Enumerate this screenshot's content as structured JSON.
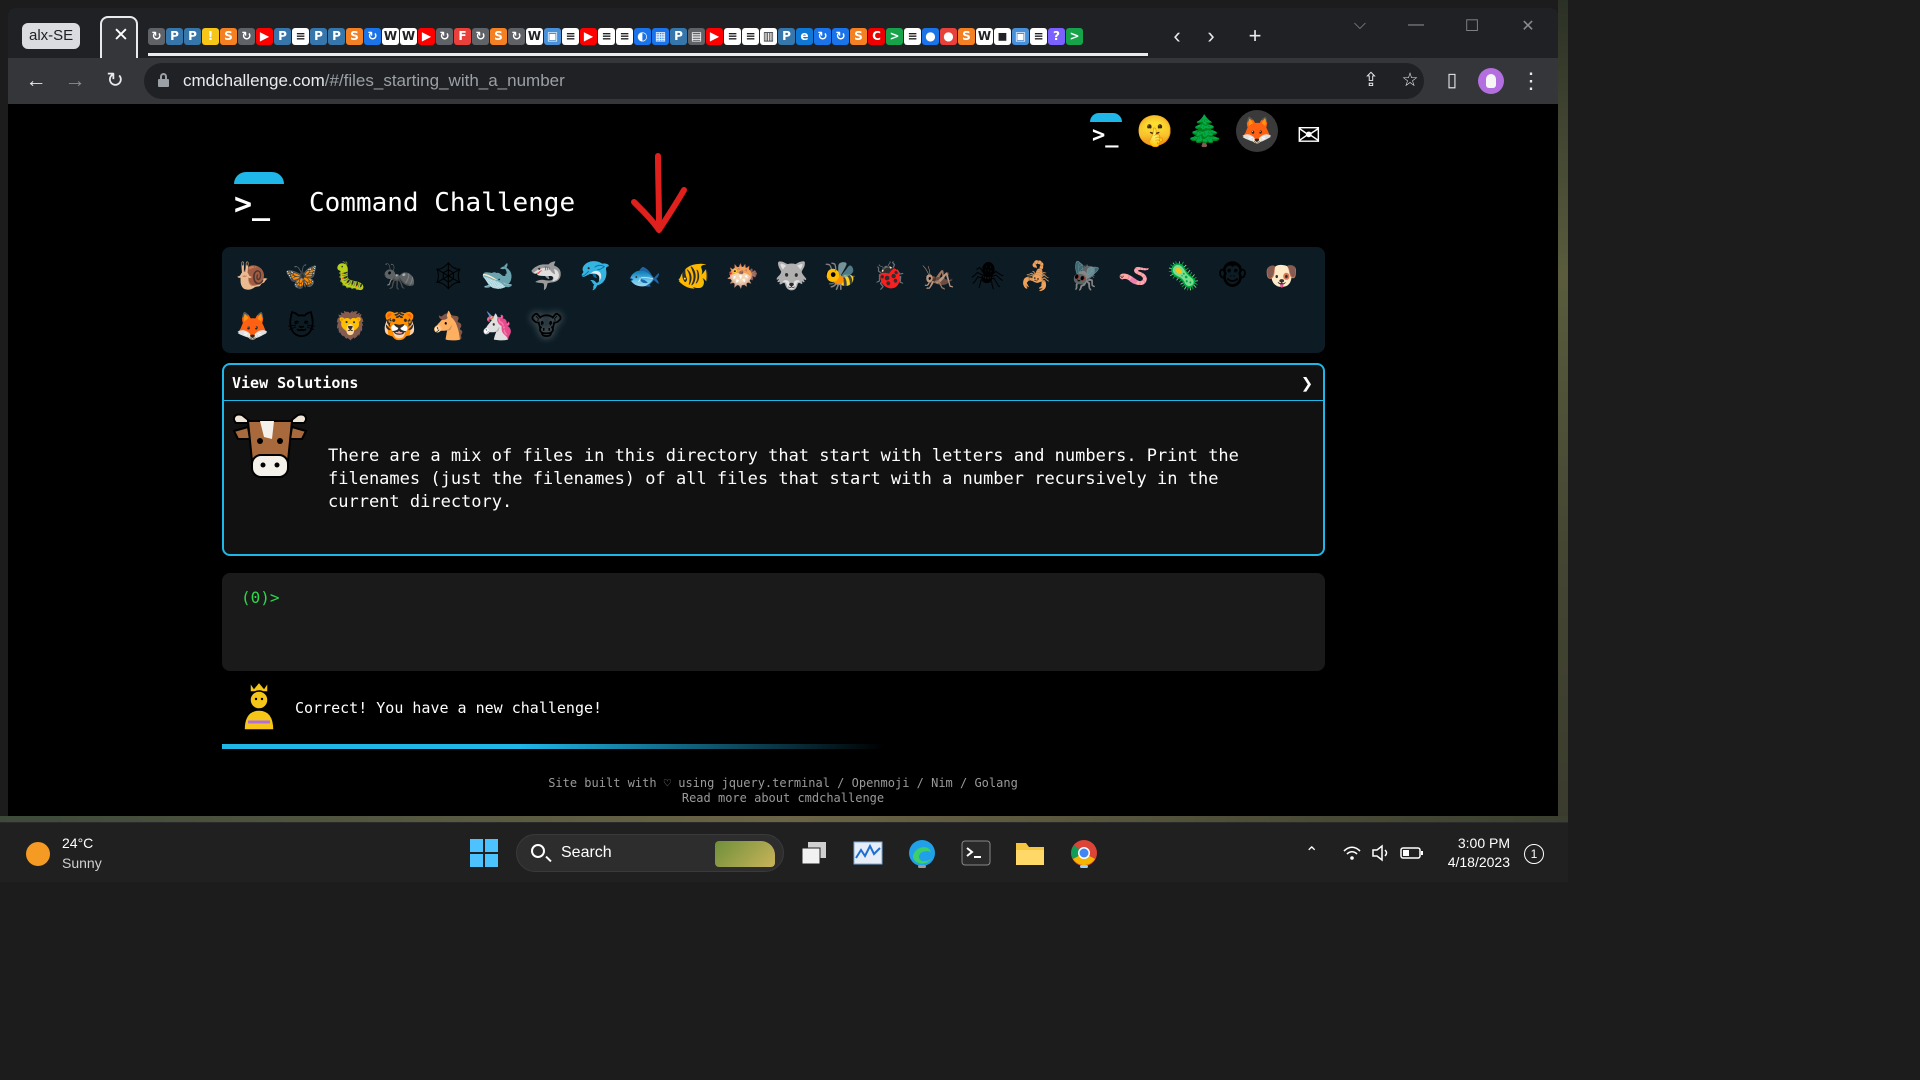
{
  "browser": {
    "tab_group_label": "alx-SE",
    "active_tab_close": "✕",
    "tab_favicons": [
      {
        "icon": "refresh-favicon",
        "color": "#5f6368",
        "glyph": "↻"
      },
      {
        "icon": "python-favicon",
        "color": "#3776ab",
        "glyph": "P"
      },
      {
        "icon": "python-favicon",
        "color": "#3776ab",
        "glyph": "P"
      },
      {
        "icon": "generic-favicon",
        "color": "#f5c518",
        "glyph": "!"
      },
      {
        "icon": "stackoverflow-favicon",
        "color": "#f48024",
        "glyph": "S"
      },
      {
        "icon": "refresh-favicon",
        "color": "#5f6368",
        "glyph": "↻"
      },
      {
        "icon": "youtube-favicon",
        "color": "#ff0000",
        "glyph": "▶"
      },
      {
        "icon": "python-favicon",
        "color": "#3776ab",
        "glyph": "P"
      },
      {
        "icon": "doc-favicon",
        "color": "#ffffff",
        "glyph": "≡"
      },
      {
        "icon": "python-favicon",
        "color": "#3776ab",
        "glyph": "P"
      },
      {
        "icon": "python-favicon",
        "color": "#3776ab",
        "glyph": "P"
      },
      {
        "icon": "stackoverflow-favicon",
        "color": "#f48024",
        "glyph": "S"
      },
      {
        "icon": "refresh-favicon",
        "color": "#1a73e8",
        "glyph": "↻"
      },
      {
        "icon": "wikipedia-favicon",
        "color": "#ffffff",
        "glyph": "W"
      },
      {
        "icon": "wikipedia-favicon",
        "color": "#ffffff",
        "glyph": "W"
      },
      {
        "icon": "youtube-favicon",
        "color": "#ff0000",
        "glyph": "▶"
      },
      {
        "icon": "refresh-favicon",
        "color": "#5f6368",
        "glyph": "↻"
      },
      {
        "icon": "freecodecamp-favicon",
        "color": "#e8403a",
        "glyph": "F"
      },
      {
        "icon": "refresh-favicon",
        "color": "#5f6368",
        "glyph": "↻"
      },
      {
        "icon": "stackoverflow-favicon",
        "color": "#f48024",
        "glyph": "S"
      },
      {
        "icon": "refresh-favicon",
        "color": "#5f6368",
        "glyph": "↻"
      },
      {
        "icon": "wikipedia-favicon",
        "color": "#ffffff",
        "glyph": "W"
      },
      {
        "icon": "image-favicon",
        "color": "#4a90d9",
        "glyph": "▣"
      },
      {
        "icon": "doc-favicon",
        "color": "#ffffff",
        "glyph": "≡"
      },
      {
        "icon": "youtube-favicon",
        "color": "#ff0000",
        "glyph": "▶"
      },
      {
        "icon": "doc-favicon",
        "color": "#ffffff",
        "glyph": "≡"
      },
      {
        "icon": "doc-favicon",
        "color": "#ffffff",
        "glyph": "≡"
      },
      {
        "icon": "circle-favicon",
        "color": "#1a73e8",
        "glyph": "◐"
      },
      {
        "icon": "grid-favicon",
        "color": "#1a73e8",
        "glyph": "▦"
      },
      {
        "icon": "python-favicon",
        "color": "#3776ab",
        "glyph": "P"
      },
      {
        "icon": "list-favicon",
        "color": "#5f6368",
        "glyph": "▤"
      },
      {
        "icon": "youtube-favicon",
        "color": "#ff0000",
        "glyph": "▶"
      },
      {
        "icon": "doc-favicon",
        "color": "#ffffff",
        "glyph": "≡"
      },
      {
        "icon": "doc-favicon",
        "color": "#ffffff",
        "glyph": "≡"
      },
      {
        "icon": "book-favicon",
        "color": "#ffffff",
        "glyph": "▥"
      },
      {
        "icon": "python-favicon",
        "color": "#3776ab",
        "glyph": "P"
      },
      {
        "icon": "edge-favicon",
        "color": "#0f78d4",
        "glyph": "e"
      },
      {
        "icon": "refresh-favicon",
        "color": "#1a73e8",
        "glyph": "↻"
      },
      {
        "icon": "refresh-favicon",
        "color": "#1a73e8",
        "glyph": "↻"
      },
      {
        "icon": "stackoverflow-favicon",
        "color": "#f48024",
        "glyph": "S"
      },
      {
        "icon": "redhat-favicon",
        "color": "#ee0000",
        "glyph": "C"
      },
      {
        "icon": "terminal-favicon",
        "color": "#16a34a",
        "glyph": ">"
      },
      {
        "icon": "doc-favicon",
        "color": "#ffffff",
        "glyph": "≡"
      },
      {
        "icon": "circle-favicon",
        "color": "#1a73e8",
        "glyph": "●"
      },
      {
        "icon": "circle-favicon",
        "color": "#e8403a",
        "glyph": "●"
      },
      {
        "icon": "stackoverflow-favicon",
        "color": "#f48024",
        "glyph": "S"
      },
      {
        "icon": "wikipedia-favicon",
        "color": "#ffffff",
        "glyph": "W"
      },
      {
        "icon": "zoom-favicon",
        "color": "#ffffff",
        "glyph": "◼"
      },
      {
        "icon": "image-favicon",
        "color": "#4a90d9",
        "glyph": "▣"
      },
      {
        "icon": "doc-favicon",
        "color": "#ffffff",
        "glyph": "≡"
      },
      {
        "icon": "question-favicon",
        "color": "#7b61ff",
        "glyph": "?"
      },
      {
        "icon": "terminal-favicon",
        "color": "#16a34a",
        "glyph": ">"
      }
    ],
    "back_icon": "←",
    "forward_icon": "→",
    "reload_icon": "↻",
    "url_host": "cmdchallenge.com",
    "url_path": "/#/files_starting_with_a_number",
    "share_icon": "⇪",
    "star_icon": "☆",
    "sidepanel_icon": "▯",
    "menu_icon": "⋮",
    "tab_scroll_left": "‹",
    "tab_scroll_right": "›",
    "new_tab": "+",
    "win_chevron": "⌵",
    "win_minimize": "—",
    "win_maximize": "☐",
    "win_close": "✕"
  },
  "site": {
    "title": "Command Challenge",
    "top_icons": [
      {
        "name": "cmd-logo-icon",
        "glyph": ""
      },
      {
        "name": "shushing-face-icon",
        "glyph": "🤫"
      },
      {
        "name": "tree-icon",
        "glyph": "🌲"
      },
      {
        "name": "gitlab-icon",
        "glyph": "🦊"
      },
      {
        "name": "mail-icon",
        "glyph": "✉"
      }
    ],
    "animals": [
      {
        "name": "snail",
        "glyph": "🐌"
      },
      {
        "name": "butterfly",
        "glyph": "🦋"
      },
      {
        "name": "caterpillar",
        "glyph": "🐛"
      },
      {
        "name": "ant",
        "glyph": "🐜"
      },
      {
        "name": "spider-web",
        "glyph": "🕸"
      },
      {
        "name": "whale",
        "glyph": "🐋"
      },
      {
        "name": "shark",
        "glyph": "🦈"
      },
      {
        "name": "dolphin",
        "glyph": "🐬"
      },
      {
        "name": "fish",
        "glyph": "🐟"
      },
      {
        "name": "tropical-fish",
        "glyph": "🐠"
      },
      {
        "name": "blowfish",
        "glyph": "🐡"
      },
      {
        "name": "wolf",
        "glyph": "🐺"
      },
      {
        "name": "bee",
        "glyph": "🐝"
      },
      {
        "name": "ladybug",
        "glyph": "🐞"
      },
      {
        "name": "cricket",
        "glyph": "🦗"
      },
      {
        "name": "spider",
        "glyph": "🕷"
      },
      {
        "name": "scorpion",
        "glyph": "🦂"
      },
      {
        "name": "fly",
        "glyph": "🪰"
      },
      {
        "name": "worm",
        "glyph": "🪱"
      },
      {
        "name": "microbe",
        "glyph": "🦠"
      },
      {
        "name": "monkey",
        "glyph": "🐵"
      },
      {
        "name": "dog",
        "glyph": "🐶"
      },
      {
        "name": "fox",
        "glyph": "🦊"
      },
      {
        "name": "cat",
        "glyph": "🐱"
      },
      {
        "name": "lion",
        "glyph": "🦁"
      },
      {
        "name": "tiger",
        "glyph": "🐯"
      },
      {
        "name": "horse",
        "glyph": "🐴"
      },
      {
        "name": "unicorn",
        "glyph": "🦄"
      },
      {
        "name": "cow",
        "glyph": "🐮",
        "current": true
      }
    ],
    "view_solutions_label": "View Solutions",
    "view_solutions_chevron": "❯",
    "challenge_text": "There are a mix of files in this directory that start with letters and numbers. Print the filenames (just the filenames) of all files that start with a number recursively in the current directory.",
    "terminal_prompt": "(0)>",
    "result_text": "Correct! You have a new challenge!",
    "progress_fraction": 0.6,
    "footer_line1": "Site built with ♡ using jquery.terminal / Openmoji / Nim / Golang",
    "footer_line2": "Read more about cmdchallenge",
    "colors": {
      "accent": "#1fb6e8",
      "prompt": "#2bd94a",
      "arrow": "#e0201c"
    }
  },
  "taskbar": {
    "weather_temp": "24°C",
    "weather_condition": "Sunny",
    "search_label": "Search",
    "time": "3:00 PM",
    "date": "4/18/2023",
    "notification_count": "1",
    "tray_chevron": "⌃",
    "wifi_icon": "◠",
    "volume_icon": "🔈",
    "battery_icon": "▭"
  }
}
